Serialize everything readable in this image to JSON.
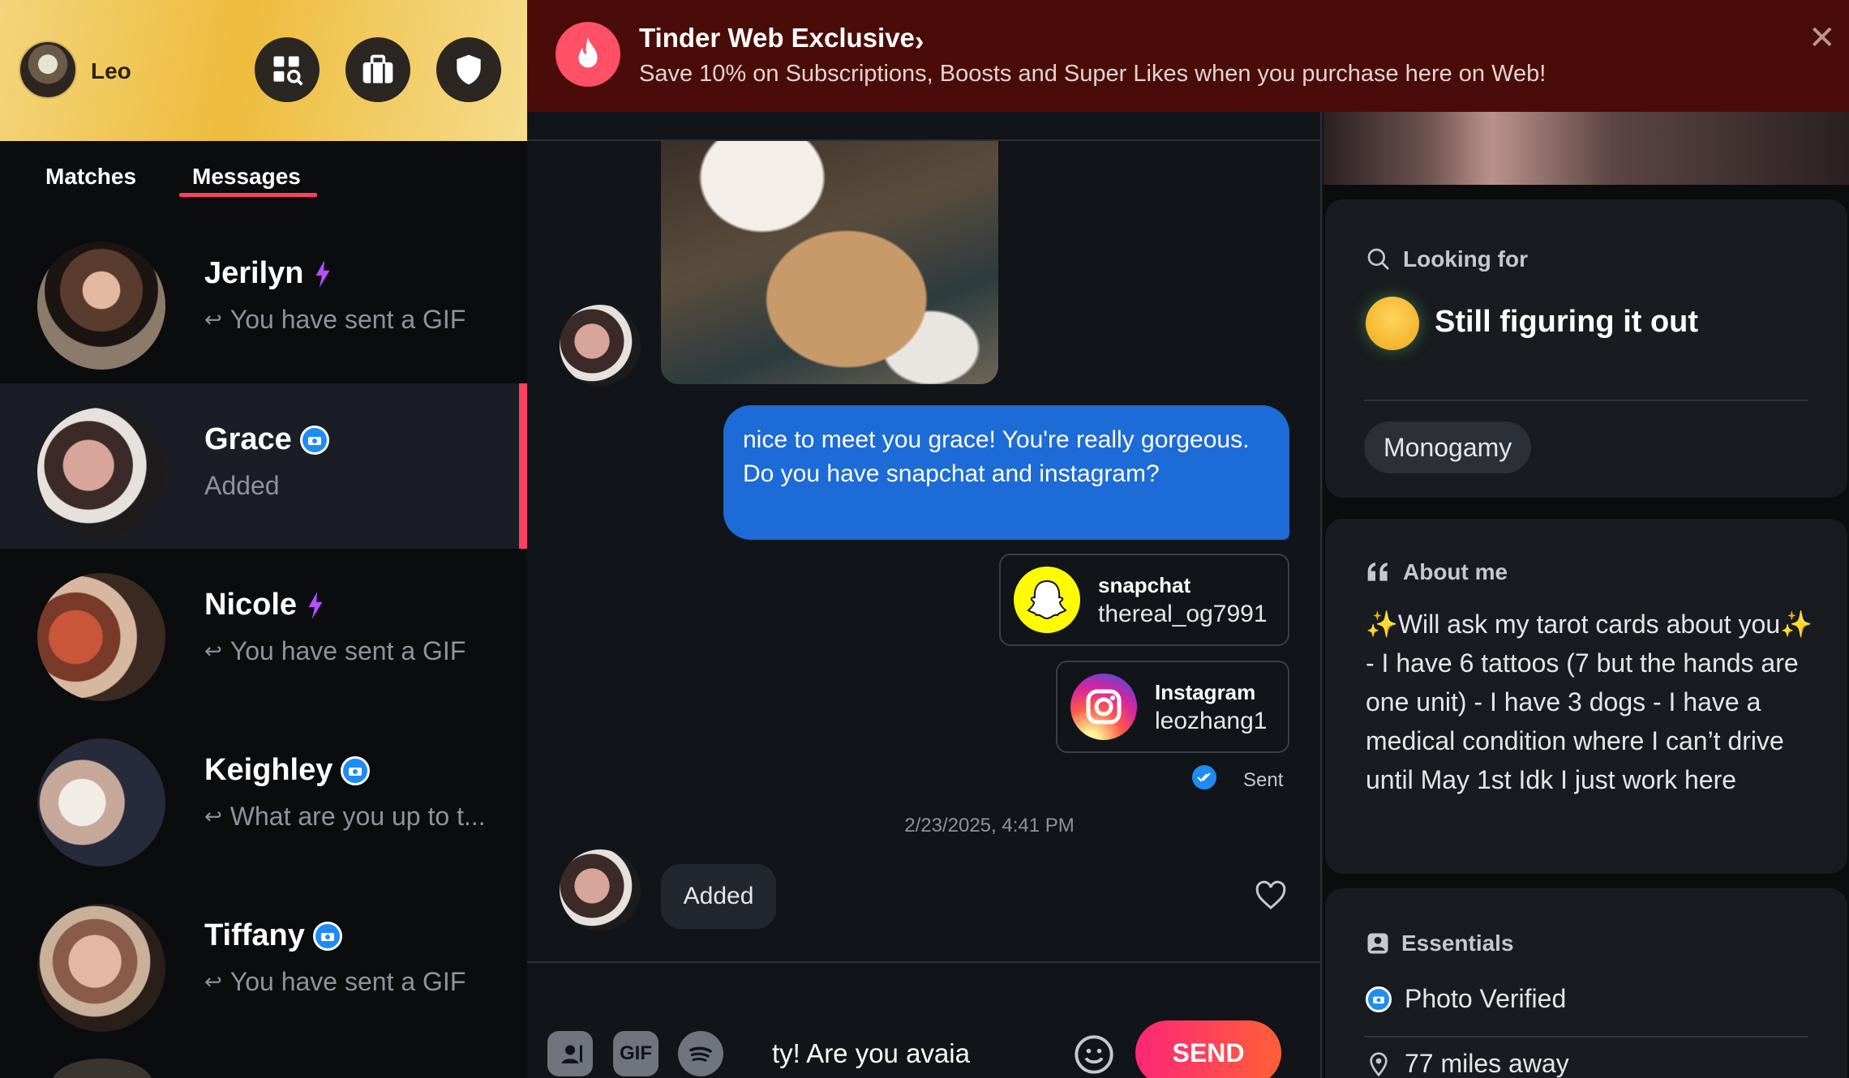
{
  "user": {
    "name": "Leo"
  },
  "tabs": {
    "matches": "Matches",
    "messages": "Messages"
  },
  "conversations": [
    {
      "name": "Jerilyn",
      "preview": "You have sent a GIF",
      "badge": "superlike",
      "selected": false
    },
    {
      "name": "Grace",
      "preview": "Added",
      "badge": "verified",
      "selected": true
    },
    {
      "name": "Nicole",
      "preview": "You have sent a GIF",
      "badge": "superlike",
      "selected": false
    },
    {
      "name": "Keighley",
      "preview": "What are you up to t...",
      "badge": "verified",
      "selected": false
    },
    {
      "name": "Tiffany",
      "preview": "You have sent a GIF",
      "badge": "verified",
      "selected": false
    }
  ],
  "banner": {
    "title": "Tinder Web Exclusive",
    "subtitle": "Save 10% on Subscriptions, Boosts and Super Likes when you purchase here on Web!"
  },
  "chat": {
    "outgoing_message": "nice to meet you grace! You're really gorgeous. Do you have snapchat and instagram?",
    "snapchat": {
      "label": "snapchat",
      "handle": "thereal_og7991"
    },
    "instagram": {
      "label": "Instagram",
      "handle": "leozhang1"
    },
    "sent_status": "Sent",
    "timestamp": "2/23/2025, 4:41 PM",
    "incoming_message": "Added",
    "composer_text": "ty! Are you avaia",
    "gif_label": "GIF",
    "send_label": "SEND"
  },
  "profile": {
    "looking_for": {
      "title": "Looking for",
      "value": "Still figuring it out",
      "tag": "Monogamy"
    },
    "about": {
      "title": "About me",
      "text": "✨Will ask my tarot cards about you✨ - I have 6 tattoos (7 but the hands are one unit) - I have 3 dogs - I have a medical condition where I can’t drive until May 1st Idk I just work here"
    },
    "essentials": {
      "title": "Essentials",
      "verified": "Photo Verified",
      "distance": "77 miles away"
    }
  },
  "colors": {
    "accent": "#fd3f61",
    "bubble_blue": "#1d6bd6",
    "banner_bg": "#4a0c08",
    "header_gold": "#f4d47a",
    "superlike": "#b64dff",
    "verified": "#1e8cf3"
  },
  "icons": [
    "explore-icon",
    "briefcase-icon",
    "shield-icon",
    "flame-icon",
    "close-icon",
    "search-icon",
    "quote-icon",
    "id-icon",
    "pin-icon",
    "heart-icon",
    "emoji-icon",
    "spotify-icon",
    "contact-card-icon"
  ]
}
